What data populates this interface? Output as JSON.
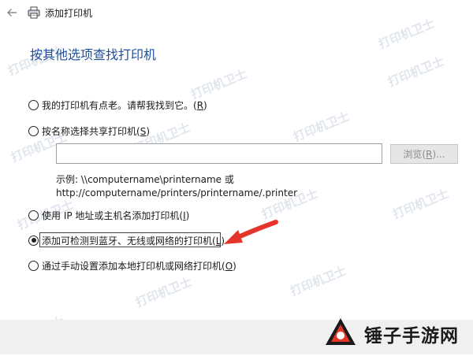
{
  "window": {
    "title": "添加打印机",
    "back_icon": "back-arrow-icon",
    "printer_icon": "printer-icon"
  },
  "heading": "按其他选项查找打印机",
  "options": [
    {
      "text": "我的打印机有点老。请帮我找到它。",
      "key": "R",
      "selected": false
    },
    {
      "text": "按名称选择共享打印机",
      "key": "S",
      "selected": false
    },
    {
      "text": "使用 IP 地址或主机名添加打印机",
      "key": "I",
      "selected": false
    },
    {
      "text": "添加可检测到蓝牙、无线或网络的打印机",
      "key": "L",
      "selected": true
    },
    {
      "text": "通过手动设置添加本地打印机或网络打印机",
      "key": "O",
      "selected": false
    }
  ],
  "shared_name_input": {
    "value": "",
    "placeholder": ""
  },
  "browse_button": {
    "text": "浏览",
    "key": "R",
    "label": "浏览(R)...",
    "enabled": false
  },
  "example": {
    "line1": "示例: \\\\computername\\printername 或",
    "line2": "http://computername/printers/printername/.printer"
  },
  "watermark_text": "打印机卫士",
  "brand": {
    "name": "锤子手游网"
  },
  "colors": {
    "heading": "#1f4e9c",
    "arrow": "#e5352b",
    "footer": "#f0f0f0",
    "brand_accent": "#e5352b"
  }
}
